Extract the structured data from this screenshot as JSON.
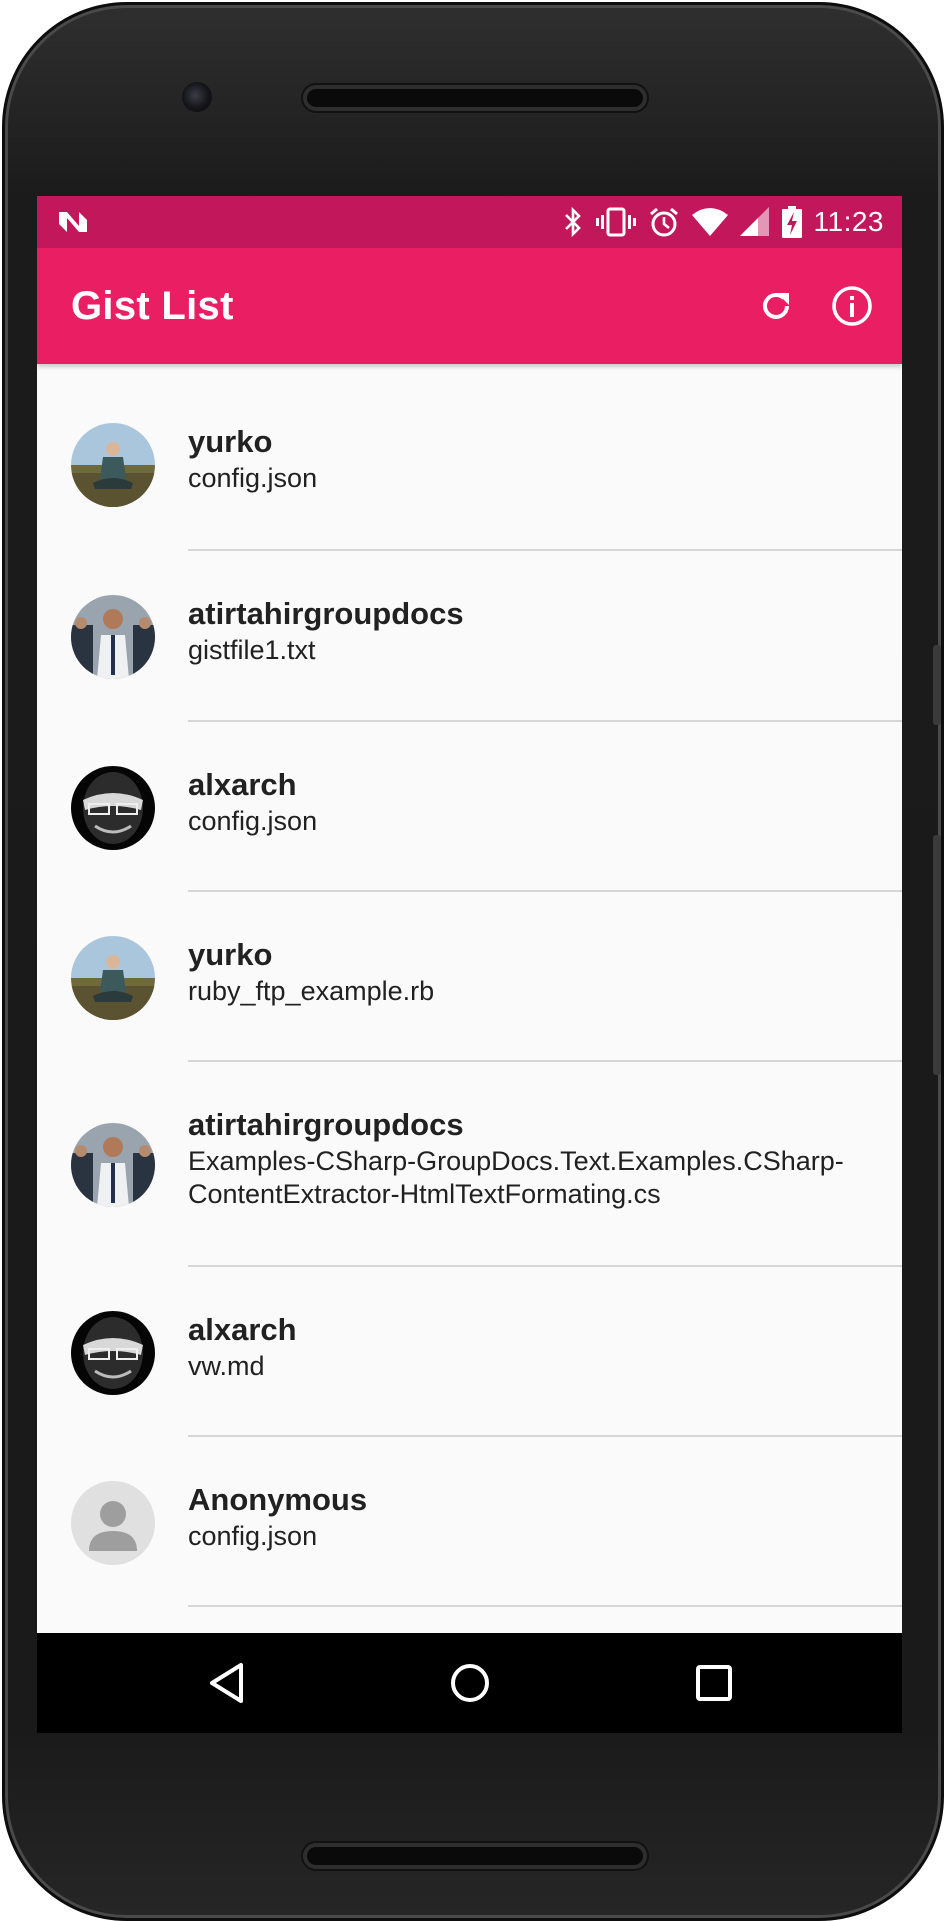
{
  "status_bar": {
    "time": "11:23",
    "icons": [
      "notification-n-icon",
      "bluetooth-icon",
      "vibrate-icon",
      "alarm-icon",
      "wifi-icon",
      "cell-signal-icon",
      "battery-charging-icon"
    ]
  },
  "app_bar": {
    "title": "Gist List",
    "actions": [
      "refresh-icon",
      "info-icon"
    ]
  },
  "colors": {
    "status_bar": "#c2185b",
    "app_bar": "#e91e63",
    "background": "#fafafa",
    "text": "#212121"
  },
  "gists": [
    {
      "owner": "yurko",
      "file": "config.json",
      "avatar": "photo-meditating-person"
    },
    {
      "owner": "atirtahirgroupdocs",
      "file": "gistfile1.txt",
      "avatar": "photo-group"
    },
    {
      "owner": "alxarch",
      "file": "config.json",
      "avatar": "photo-bw-face"
    },
    {
      "owner": "yurko",
      "file": "ruby_ftp_example.rb",
      "avatar": "photo-meditating-person"
    },
    {
      "owner": "atirtahirgroupdocs",
      "file": "Examples-CSharp-GroupDocs.Text.Examples.CSharp-ContentExtractor-HtmlTextFormating.cs",
      "avatar": "photo-group"
    },
    {
      "owner": "alxarch",
      "file": "vw.md",
      "avatar": "photo-bw-face"
    },
    {
      "owner": "Anonymous",
      "file": "config.json",
      "avatar": "default-person-icon"
    }
  ],
  "nav_bar": [
    "back-icon",
    "home-icon",
    "recents-icon"
  ]
}
